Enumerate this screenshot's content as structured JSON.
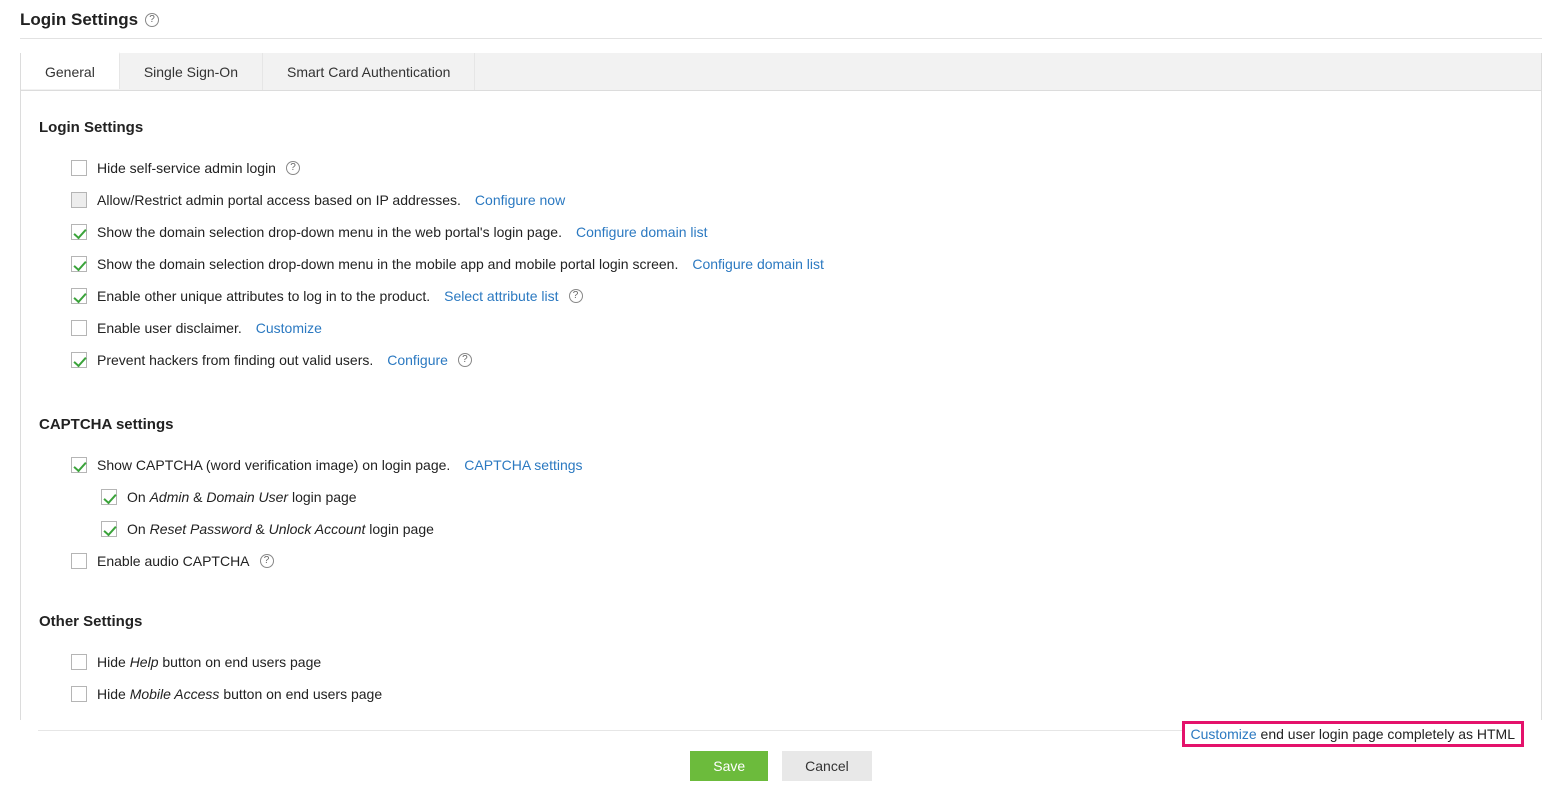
{
  "page_title": "Login Settings",
  "tabs": {
    "general": "General",
    "sso": "Single Sign-On",
    "smartcard": "Smart Card Authentication"
  },
  "sections": {
    "login_settings": "Login Settings",
    "captcha_settings": "CAPTCHA settings",
    "other_settings": "Other Settings"
  },
  "items": {
    "hide_self_service": "Hide self-service admin login",
    "allow_restrict_ip": "Allow/Restrict admin portal access based on IP addresses.",
    "configure_now": "Configure now",
    "show_domain_web": "Show the domain selection drop-down menu in the web portal's login page.",
    "configure_domain_list": "Configure domain list",
    "show_domain_mobile": "Show the domain selection drop-down menu in the mobile app and mobile portal login screen.",
    "enable_unique_attr": "Enable other unique attributes to log in to the product.",
    "select_attribute_list": "Select attribute list",
    "enable_disclaimer": "Enable user disclaimer.",
    "customize": "Customize",
    "prevent_hackers": "Prevent hackers from finding out valid users.",
    "configure": "Configure",
    "show_captcha": "Show CAPTCHA (word verification image) on login page.",
    "captcha_settings_link": "CAPTCHA settings",
    "on_admin_pre": "On ",
    "admin": "Admin",
    "amp": " & ",
    "domain_user": "Domain User",
    "login_page_suffix": " login page",
    "reset_password": "Reset Password",
    "unlock_account": "Unlock Account",
    "enable_audio": "Enable audio CAPTCHA",
    "hide_help_pre": "Hide ",
    "help": "Help",
    "button_end_users": " button on end users page",
    "mobile_access": "Mobile Access",
    "customize_end_user": " end user login page completely as HTML",
    "customize_link": "Customize"
  },
  "buttons": {
    "save": "Save",
    "cancel": "Cancel"
  },
  "help_glyph": "?"
}
